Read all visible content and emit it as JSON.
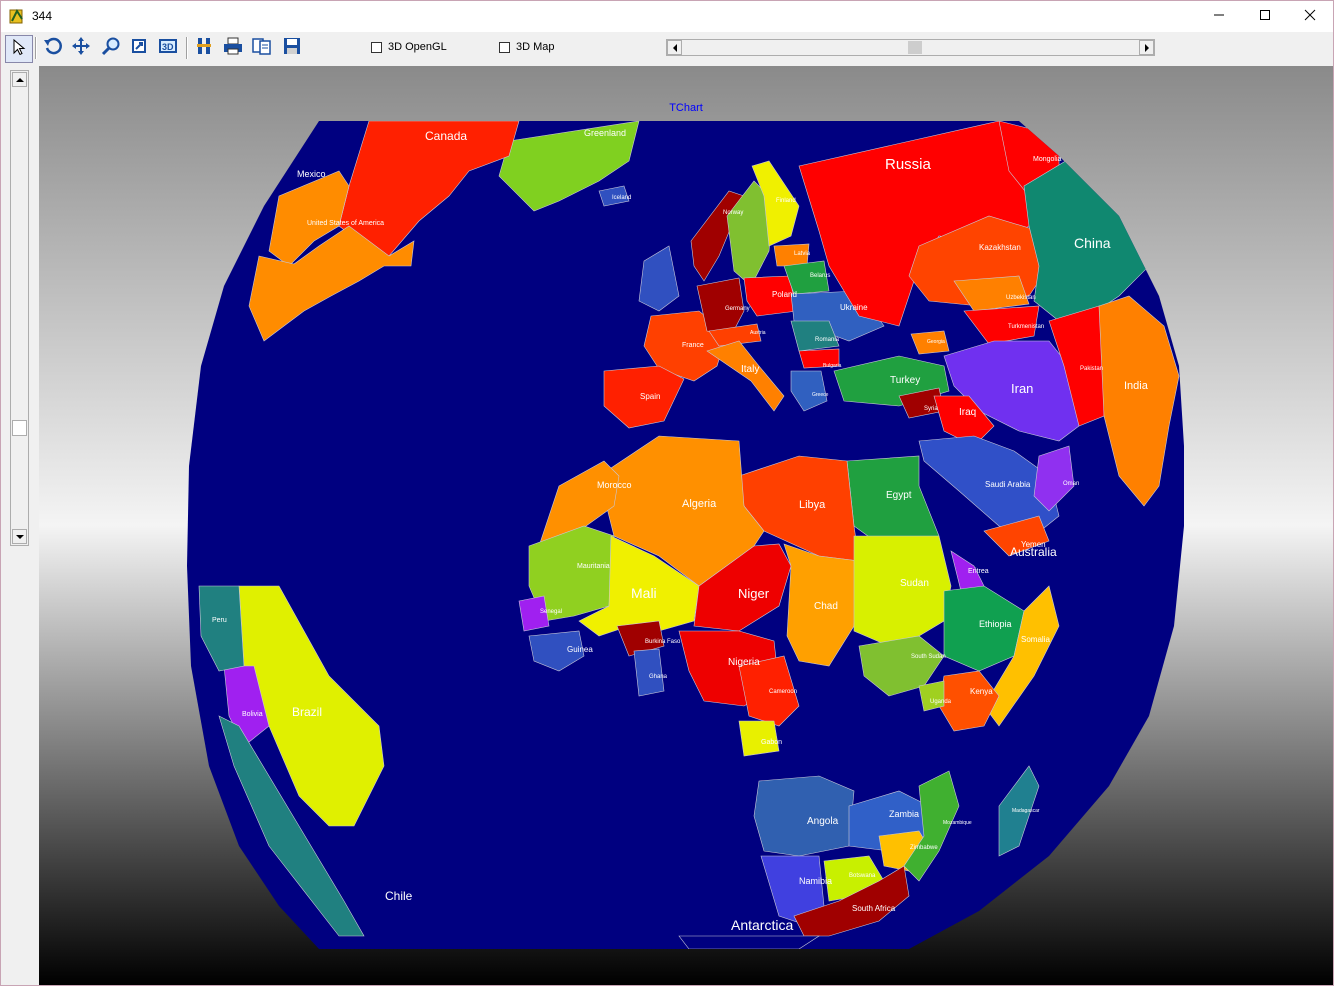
{
  "window": {
    "title": "344",
    "controls": {
      "minimize": "—",
      "maximize": "☐",
      "close": "✕"
    }
  },
  "toolbar": {
    "buttons": [
      {
        "name": "select-tool-button",
        "icon": "pointer-icon"
      },
      {
        "name": "rotate-tool-button",
        "icon": "rotate-icon"
      },
      {
        "name": "move-tool-button",
        "icon": "move-icon"
      },
      {
        "name": "zoom-tool-button",
        "icon": "zoom-icon"
      },
      {
        "name": "depth-tool-button",
        "icon": "depth-icon"
      },
      {
        "name": "3d-tool-button",
        "icon": "3d-icon"
      },
      {
        "name": "edit-tool-button",
        "icon": "edit-icon"
      },
      {
        "name": "print-button",
        "icon": "print-icon"
      },
      {
        "name": "copy-button",
        "icon": "copy-icon"
      },
      {
        "name": "save-button",
        "icon": "save-icon"
      }
    ],
    "opengl_label": "3D OpenGL",
    "map3d_label": "3D Map",
    "opengl_checked": false,
    "map3d_checked": false
  },
  "chart": {
    "title": "TChart",
    "background_top": "#8a8a8a",
    "background_bottom": "#000000",
    "ocean_color": "#000080"
  },
  "chart_data": {
    "type": "map",
    "projection": "orthographic",
    "title": "TChart",
    "regions": [
      {
        "name": "Canada",
        "color": "#ff2000"
      },
      {
        "name": "Greenland",
        "color": "#80d020"
      },
      {
        "name": "Mexico",
        "color": "#ff8c00"
      },
      {
        "name": "United States of America",
        "color": "#ff8c00"
      },
      {
        "name": "Russia",
        "color": "#ff0000"
      },
      {
        "name": "Mongolia",
        "color": "#ff0000"
      },
      {
        "name": "China",
        "color": "#108870"
      },
      {
        "name": "Kazakhstan",
        "color": "#ff4400"
      },
      {
        "name": "Uzbekistan",
        "color": "#ff8000"
      },
      {
        "name": "Turkmenistan",
        "color": "#ff0000"
      },
      {
        "name": "India",
        "color": "#ff8000"
      },
      {
        "name": "Iran",
        "color": "#7030f0"
      },
      {
        "name": "Pakistan",
        "color": "#ff0000"
      },
      {
        "name": "Iraq",
        "color": "#ff0000"
      },
      {
        "name": "Turkey",
        "color": "#20a040"
      },
      {
        "name": "Saudi Arabia",
        "color": "#3050c8"
      },
      {
        "name": "Yemen",
        "color": "#ff4400"
      },
      {
        "name": "Oman",
        "color": "#9030f0"
      },
      {
        "name": "Egypt",
        "color": "#20a040"
      },
      {
        "name": "Libya",
        "color": "#ff4000"
      },
      {
        "name": "Algeria",
        "color": "#ff9000"
      },
      {
        "name": "Morocco",
        "color": "#ff9000"
      },
      {
        "name": "Mauritania",
        "color": "#90d020"
      },
      {
        "name": "Mali",
        "color": "#f0f000"
      },
      {
        "name": "Niger",
        "color": "#ee0000"
      },
      {
        "name": "Chad",
        "color": "#ffa000"
      },
      {
        "name": "Sudan",
        "color": "#d8f000"
      },
      {
        "name": "South Sudan",
        "color": "#80c030"
      },
      {
        "name": "Ethiopia",
        "color": "#10a050"
      },
      {
        "name": "Eritrea",
        "color": "#a020f0"
      },
      {
        "name": "Somalia",
        "color": "#ffc000"
      },
      {
        "name": "Kenya",
        "color": "#ff5000"
      },
      {
        "name": "Uganda",
        "color": "#a0d020"
      },
      {
        "name": "Nigeria",
        "color": "#ee0000"
      },
      {
        "name": "Burkina Faso",
        "color": "#a00000"
      },
      {
        "name": "Ghana",
        "color": "#3050c0"
      },
      {
        "name": "Guinea",
        "color": "#3050c0"
      },
      {
        "name": "Senegal",
        "color": "#a020f0"
      },
      {
        "name": "Cameroon",
        "color": "#ff2000"
      },
      {
        "name": "Gabon",
        "color": "#e8f000"
      },
      {
        "name": "Angola",
        "color": "#3060b0"
      },
      {
        "name": "Zambia",
        "color": "#3060c8"
      },
      {
        "name": "Zimbabwe",
        "color": "#ffc000"
      },
      {
        "name": "Mozambique",
        "color": "#40b030"
      },
      {
        "name": "Madagascar",
        "color": "#208090"
      },
      {
        "name": "Namibia",
        "color": "#4040e0"
      },
      {
        "name": "Botswana",
        "color": "#c8f000"
      },
      {
        "name": "South Africa",
        "color": "#a00000"
      },
      {
        "name": "France",
        "color": "#ff4000"
      },
      {
        "name": "Spain",
        "color": "#ff2000"
      },
      {
        "name": "Italy",
        "color": "#ff8000"
      },
      {
        "name": "Germany",
        "color": "#a00000"
      },
      {
        "name": "Poland",
        "color": "#ff0000"
      },
      {
        "name": "Ukraine",
        "color": "#3060c0"
      },
      {
        "name": "Belarus",
        "color": "#20a040"
      },
      {
        "name": "Latvia",
        "color": "#ff8000"
      },
      {
        "name": "Romania",
        "color": "#208080"
      },
      {
        "name": "Bulgaria",
        "color": "#ff0000"
      },
      {
        "name": "Greece",
        "color": "#3060c0"
      },
      {
        "name": "Austria",
        "color": "#ff4000"
      },
      {
        "name": "Finland",
        "color": "#f0f000"
      },
      {
        "name": "Norway",
        "color": "#a00000"
      },
      {
        "name": "Sweden",
        "color": "#80c030"
      },
      {
        "name": "United Kingdom",
        "color": "#3050c0"
      },
      {
        "name": "Iceland",
        "color": "#3050c0"
      },
      {
        "name": "Georgia",
        "color": "#ff8000"
      },
      {
        "name": "Syria",
        "color": "#a00000"
      },
      {
        "name": "Brazil",
        "color": "#e0f000"
      },
      {
        "name": "Bolivia",
        "color": "#a020f0"
      },
      {
        "name": "Peru",
        "color": "#208080"
      },
      {
        "name": "Chile",
        "color": "#208080"
      },
      {
        "name": "Antarctica",
        "color": "#000080"
      }
    ],
    "labels": [
      {
        "text": "Canada"
      },
      {
        "text": "Greenland"
      },
      {
        "text": "Mexico"
      },
      {
        "text": "United States of America"
      },
      {
        "text": "Russia"
      },
      {
        "text": "Mongolia"
      },
      {
        "text": "China"
      },
      {
        "text": "Kazakhstan"
      },
      {
        "text": "Uzbekistan"
      },
      {
        "text": "Turkmenistan"
      },
      {
        "text": "India"
      },
      {
        "text": "Iran"
      },
      {
        "text": "Pakistan"
      },
      {
        "text": "Iraq"
      },
      {
        "text": "Turkey"
      },
      {
        "text": "Saudi Arabia"
      },
      {
        "text": "Yemen"
      },
      {
        "text": "Australia"
      },
      {
        "text": "Oman"
      },
      {
        "text": "Egypt"
      },
      {
        "text": "Libya"
      },
      {
        "text": "Algeria"
      },
      {
        "text": "Morocco"
      },
      {
        "text": "Mauritania"
      },
      {
        "text": "Mali"
      },
      {
        "text": "Niger"
      },
      {
        "text": "Chad"
      },
      {
        "text": "Sudan"
      },
      {
        "text": "South Sudan"
      },
      {
        "text": "Ethiopia"
      },
      {
        "text": "Eritrea"
      },
      {
        "text": "Somalia"
      },
      {
        "text": "Kenya"
      },
      {
        "text": "Uganda"
      },
      {
        "text": "Nigeria"
      },
      {
        "text": "Burkina Faso"
      },
      {
        "text": "Ghana"
      },
      {
        "text": "Guinea"
      },
      {
        "text": "Senegal"
      },
      {
        "text": "Cameroon"
      },
      {
        "text": "Gabon"
      },
      {
        "text": "Angola"
      },
      {
        "text": "Zambia"
      },
      {
        "text": "Zimbabwe"
      },
      {
        "text": "Mozambique"
      },
      {
        "text": "Madagascar"
      },
      {
        "text": "Namibia"
      },
      {
        "text": "Botswana"
      },
      {
        "text": "South Africa"
      },
      {
        "text": "France"
      },
      {
        "text": "Spain"
      },
      {
        "text": "Italy"
      },
      {
        "text": "Germany"
      },
      {
        "text": "Poland"
      },
      {
        "text": "Ukraine"
      },
      {
        "text": "Belarus"
      },
      {
        "text": "Latvia"
      },
      {
        "text": "Romania"
      },
      {
        "text": "Bulgaria"
      },
      {
        "text": "Greece"
      },
      {
        "text": "Austria"
      },
      {
        "text": "Finland"
      },
      {
        "text": "Norway"
      },
      {
        "text": "Iceland"
      },
      {
        "text": "Georgia"
      },
      {
        "text": "Syria"
      },
      {
        "text": "Brazil"
      },
      {
        "text": "Bolivia"
      },
      {
        "text": "Peru"
      },
      {
        "text": "Chile"
      },
      {
        "text": "Antarctica"
      }
    ]
  }
}
